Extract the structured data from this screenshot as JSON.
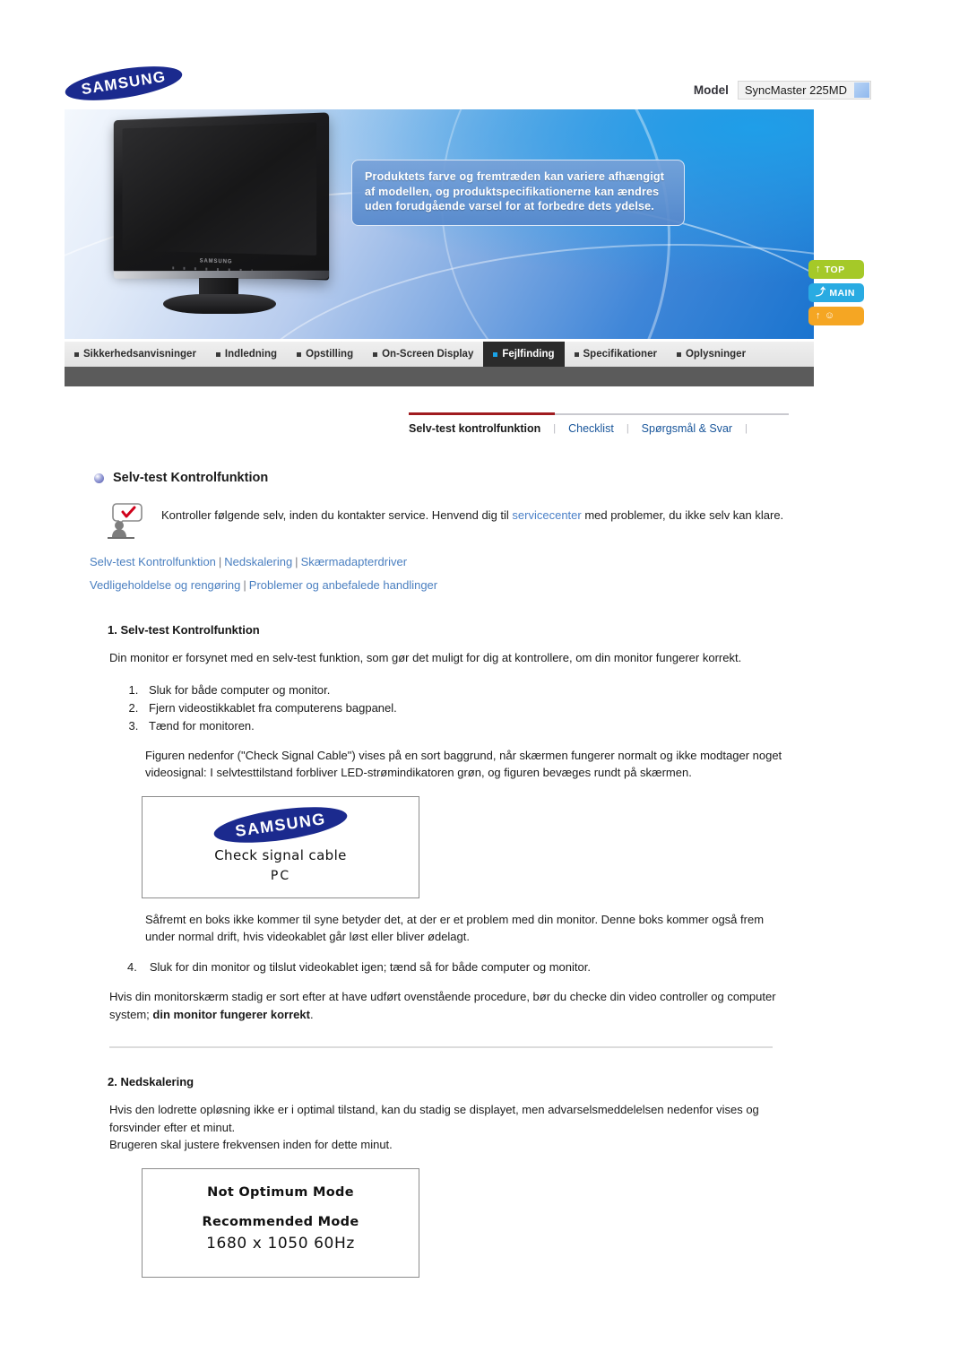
{
  "header": {
    "logo_text": "SAMSUNG",
    "model_label": "Model",
    "model_value": "SyncMaster 225MD"
  },
  "banner": {
    "callout_text": "Produktets farve og fremtræden kan variere afhængigt af modellen, og produktspecifikationerne kan ændres uden forudgående varsel for at forbedre dets ydelse.",
    "monitor_brand": "SAMSUNG"
  },
  "side_buttons": [
    {
      "label": "TOP",
      "icon": "arrow-up-icon",
      "glyph": "↑",
      "color": "#a5c928"
    },
    {
      "label": "MAIN",
      "icon": "arrow-turn-icon",
      "glyph": "⤴",
      "color": "#29abe2"
    },
    {
      "label": "",
      "icon": "arrow-up-book-icon",
      "glyph": "↑ ☲",
      "color": "#f5a623"
    }
  ],
  "main_nav": [
    {
      "label": "Sikkerhedsanvisninger",
      "active": false
    },
    {
      "label": "Indledning",
      "active": false
    },
    {
      "label": "Opstilling",
      "active": false
    },
    {
      "label": "On-Screen Display",
      "active": false
    },
    {
      "label": "Fejlfinding",
      "active": true
    },
    {
      "label": "Specifikationer",
      "active": false
    },
    {
      "label": "Oplysninger",
      "active": false
    }
  ],
  "sub_nav": [
    {
      "label": "Selv-test kontrolfunktion",
      "active": true
    },
    {
      "label": "Checklist",
      "active": false
    },
    {
      "label": "Spørgsmål & Svar",
      "active": false
    }
  ],
  "content": {
    "page_title": "Selv-test Kontrolfunktion",
    "intro_part1": "Kontroller følgende selv, inden du kontakter service. Henvend dig til ",
    "intro_link": "servicecenter",
    "intro_part2": " med problemer, du ikke selv kan klare.",
    "link_row_1": [
      "Selv-test Kontrolfunktion",
      "Nedskalering",
      "Skærmadapterdriver"
    ],
    "link_row_2": [
      "Vedligeholdelse og rengøring",
      "Problemer og anbefalede handlinger"
    ],
    "section1": {
      "heading": "1. Selv-test Kontrolfunktion",
      "intro": "Din monitor er forsynet med en selv-test funktion, som gør det muligt for dig at kontrollere, om din monitor fungerer korrekt.",
      "steps": [
        "Sluk for både computer og monitor.",
        "Fjern videostikkablet fra computerens bagpanel.",
        "Tænd for monitoren."
      ],
      "para_after_steps": "Figuren nedenfor (\"Check Signal Cable\") vises på en sort baggrund, når skærmen fungerer normalt og ikke modtager noget videosignal: I selvtesttilstand forbliver LED-strømindikatoren grøn, og figuren bevæges rundt på skærmen.",
      "screen_box": {
        "logo": "SAMSUNG",
        "line1": "Check signal cable",
        "line2": "PC"
      },
      "para_after_box": "Såfremt en boks ikke kommer til syne betyder det, at der er et problem med din monitor. Denne boks kommer også frem under normal drift, hvis videokablet går løst eller bliver ødelagt.",
      "step4_number": "4.",
      "step4": "Sluk for din monitor og tilslut videokablet igen; tænd så for både computer og monitor.",
      "closing_part1": "Hvis din monitorskærm stadig er sort efter at have udført ovenstående procedure, bør du checke din video controller og computer system; ",
      "closing_bold": "din monitor fungerer korrekt",
      "closing_part2": "."
    },
    "section2": {
      "heading": "2. Nedskalering",
      "para1": "Hvis den lodrette opløsning ikke er i optimal tilstand, kan du stadig se displayet, men advarselsmeddelelsen nedenfor vises og forsvinder efter et minut.",
      "para2": "Brugeren skal justere frekvensen inden for dette minut.",
      "screen_box": {
        "line1": "Not Optimum Mode",
        "line2": "Recommended Mode",
        "resolution": "1680 x 1050  60Hz"
      }
    }
  },
  "colors": {
    "link": "#4a7fc0",
    "active_tab_bg": "#2b2b2b",
    "accent_red": "#a01c20",
    "samsung_blue": "#1b2a8e"
  }
}
